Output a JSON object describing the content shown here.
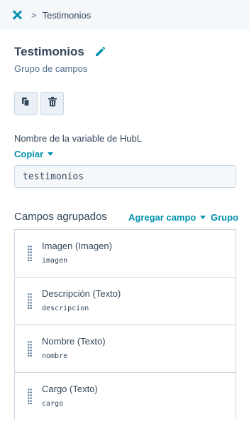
{
  "breadcrumb": {
    "close_icon": "close-x-icon",
    "separator": ">",
    "current": "Testimonios"
  },
  "header": {
    "title": "Testimonios",
    "subtitle": "Grupo de campos",
    "edit_icon": "pencil-icon"
  },
  "actions": {
    "clone_icon": "copy-icon",
    "delete_icon": "trash-icon"
  },
  "hubl": {
    "label": "Nombre de la variable de HubL",
    "copy_label": "Copiar",
    "value": "testimonios"
  },
  "grouped_fields": {
    "title": "Campos agrupados",
    "add_field_label": "Agregar campo",
    "group_label": "Grupo",
    "items": [
      {
        "name": "Imagen (Imagen)",
        "key": "imagen"
      },
      {
        "name": "Descripción (Texto)",
        "key": "descripcion"
      },
      {
        "name": "Nombre (Texto)",
        "key": "nombre"
      },
      {
        "name": "Cargo (Texto)",
        "key": "cargo"
      }
    ]
  },
  "colors": {
    "accent": "#0091ae",
    "text": "#33475b",
    "border": "#cbd6e2",
    "surface": "#f5f8fa"
  }
}
